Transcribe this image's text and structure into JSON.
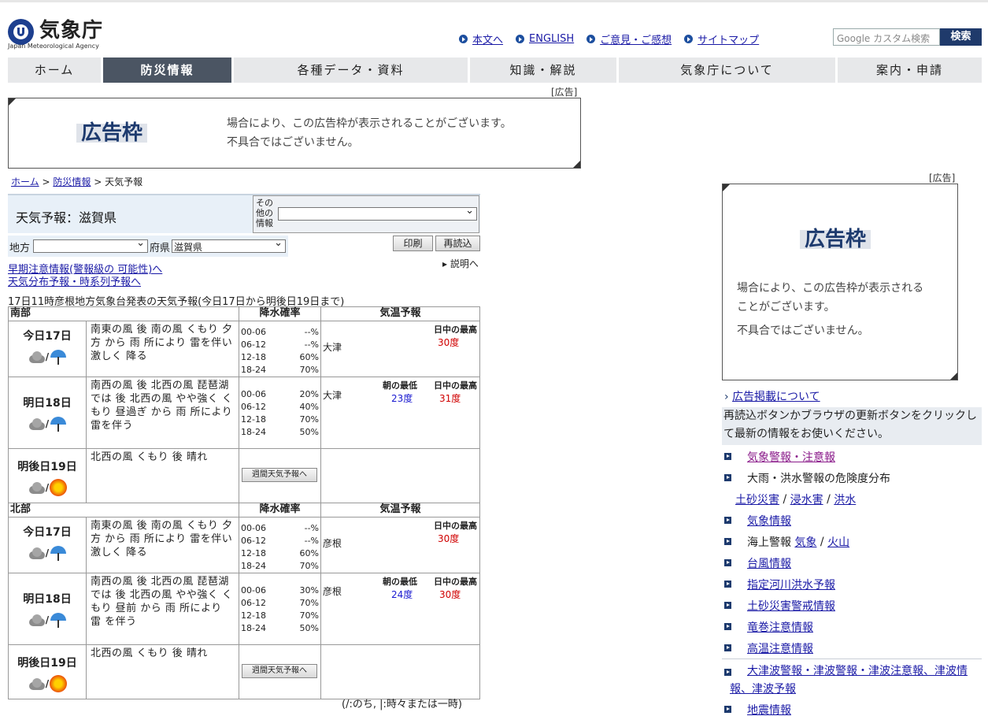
{
  "header": {
    "logo_jp": "気象庁",
    "logo_en": "Japan Meteorological Agency",
    "links": [
      "本文へ",
      "ENGLISH",
      "ご意見・ご感想",
      "サイトマップ"
    ],
    "search_placeholder": "Google カスタム検索",
    "search_button": "検索"
  },
  "nav": [
    "ホーム",
    "防災情報",
    "各種データ・資料",
    "知識・解説",
    "気象庁について",
    "案内・申請"
  ],
  "ad": {
    "label": "[広告]",
    "title": "広告枠",
    "line1": "場合により、この広告枠が表示されることがございます。",
    "line2": "不具合ではございません。",
    "side_line1": "場合により、この広告枠が表示される",
    "side_line2": "ことがございます。",
    "side_line3": "不具合ではございません。"
  },
  "breadcrumb": {
    "home": "ホーム",
    "sep": ">",
    "bousai": "防災情報",
    "current": "天気予報"
  },
  "title": "天気予報：滋賀県",
  "other_info_label": "その他の情報",
  "region_label": "地方",
  "pref_label": "府県",
  "pref_value": "滋賀県",
  "print_button": "印刷",
  "reload_button": "再読込",
  "explain_link": "説明へ",
  "links_left": [
    "早期注意情報(警報級の 可能性)へ",
    "天気分布予報・時系列予報へ"
  ],
  "issued": "17日11時彦根地方気象台発表の天気予報(今日17日から明後日19日まで)",
  "table_headers": {
    "pop": "降水確率",
    "temp": "気温予報"
  },
  "weekly_button": "週間天気予報へ",
  "regions": [
    {
      "name": "南部",
      "days": [
        {
          "day": "今日17日",
          "wx": "南東の風 後 南の風 くもり 夕方 から 雨 所により 雷を伴い 激しく 降る",
          "pop": [
            [
              "00-06",
              "--%"
            ],
            [
              "06-12",
              "--%"
            ],
            [
              "12-18",
              "60%"
            ],
            [
              "18-24",
              "70%"
            ]
          ],
          "city": "大津",
          "lo": "",
          "hi": "30度",
          "lo_label": "",
          "hi_label": "日中の最高"
        },
        {
          "day": "明日18日",
          "wx": "南西の風 後 北西の風 琵琶湖 では 後 北西の風 やや強く くもり 昼過ぎ から 雨 所により 雷を伴う",
          "pop": [
            [
              "00-06",
              "20%"
            ],
            [
              "06-12",
              "40%"
            ],
            [
              "12-18",
              "70%"
            ],
            [
              "18-24",
              "50%"
            ]
          ],
          "city": "大津",
          "lo": "23度",
          "hi": "31度",
          "lo_label": "朝の最低",
          "hi_label": "日中の最高"
        },
        {
          "day": "明後日19日",
          "wx": "北西の風 くもり 後 晴れ",
          "pop": [],
          "city": "",
          "lo": "",
          "hi": "",
          "lo_label": "",
          "hi_label": ""
        }
      ]
    },
    {
      "name": "北部",
      "days": [
        {
          "day": "今日17日",
          "wx": "南東の風 後 南の風 くもり 夕方 から 雨 所により 雷を伴い 激しく 降る",
          "pop": [
            [
              "00-06",
              "--%"
            ],
            [
              "06-12",
              "--%"
            ],
            [
              "12-18",
              "60%"
            ],
            [
              "18-24",
              "70%"
            ]
          ],
          "city": "彦根",
          "lo": "",
          "hi": "30度",
          "lo_label": "",
          "hi_label": "日中の最高"
        },
        {
          "day": "明日18日",
          "wx": "南西の風 後 北西の風 琵琶湖 では 後 北西の風 やや強く くもり 昼前 から 雨 所により 雷 を伴う",
          "pop": [
            [
              "00-06",
              "30%"
            ],
            [
              "06-12",
              "70%"
            ],
            [
              "12-18",
              "70%"
            ],
            [
              "18-24",
              "50%"
            ]
          ],
          "city": "彦根",
          "lo": "24度",
          "hi": "30度",
          "lo_label": "朝の最低",
          "hi_label": "日中の最高"
        },
        {
          "day": "明後日19日",
          "wx": "北西の風 くもり 後 晴れ",
          "pop": [],
          "city": "",
          "lo": "",
          "hi": "",
          "lo_label": "",
          "hi_label": ""
        }
      ]
    }
  ],
  "legend_note": "(/:のち, |:時々または一時)",
  "right": {
    "ad_link": "広告掲載について",
    "notice": "再読込ボタンかブラウザの更新ボタンをクリックして最新の情報をお使いください。",
    "items": [
      {
        "text": "気象警報・注意報",
        "link": true,
        "visited": true
      },
      {
        "text": "大雨・洪水警報の危険度分布",
        "link": false
      },
      {
        "text": "気象情報",
        "link": true
      },
      {
        "text": "海上警報",
        "link": false
      },
      {
        "text": "台風情報",
        "link": true
      },
      {
        "text": "指定河川洪水予報",
        "link": true
      },
      {
        "text": "土砂災害警戒情報",
        "link": true
      },
      {
        "text": "竜巻注意情報",
        "link": true
      },
      {
        "text": "高温注意情報",
        "link": true
      },
      {
        "text": "大津波警報・津波警報・津波注意報、津波情報、津波予報",
        "link": true
      },
      {
        "text": "地震情報",
        "link": true
      }
    ],
    "sub_dosha": [
      "土砂災害",
      "浸水害",
      "洪水"
    ],
    "sub_kaijo": [
      "気象",
      "火山"
    ]
  }
}
